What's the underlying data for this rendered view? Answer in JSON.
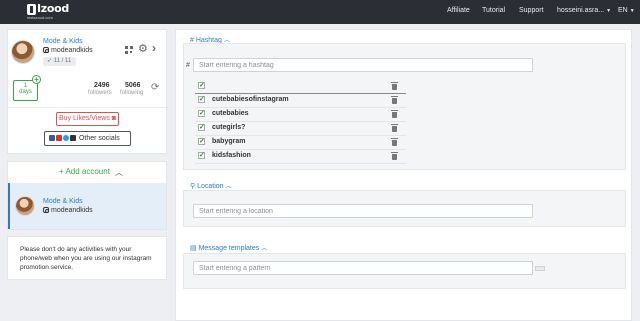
{
  "topbar": {
    "logo_text": "Izood",
    "logo_sub": "instazood.com",
    "nav": {
      "affiliate": "Affiliate",
      "tutorial": "Tutorial",
      "support": "Support",
      "user": "hosseini.asra...",
      "lang": "EN"
    }
  },
  "account": {
    "name": "Mode & Kids",
    "username": "modeandkids",
    "badge": "11 / 11",
    "days_value": "1",
    "days_label": "days",
    "followers_value": "2496",
    "followers_label": "followers",
    "following_value": "5066",
    "following_label": "following",
    "buy_button": "Buy Likes/Views",
    "other_socials": "Other socials"
  },
  "accounts_panel": {
    "add_account": "+ Add account",
    "items": [
      {
        "name": "Mode & Kids",
        "username": "modeandkids"
      }
    ]
  },
  "notice": "Please don't do any activities with your phone/web when you are using our instagram promotion service.",
  "hashtag_section": {
    "title": "# Hashtag",
    "placeholder": "Start entering a hashtag",
    "prefix": "#",
    "tags": [
      "cutebabiesofinstagram",
      "cutebabies",
      "cutegirls?",
      "babygram",
      "kidsfashion"
    ]
  },
  "location_section": {
    "title": "Location",
    "placeholder": "Start entering a location"
  },
  "message_section": {
    "title": "Message templates",
    "placeholder": "Start entering a pattern"
  },
  "colors": {
    "topbar": "#2b2f35",
    "accent_blue": "#2f79c8",
    "accent_green": "#3aa64a",
    "buy_red": "#d9534f"
  }
}
